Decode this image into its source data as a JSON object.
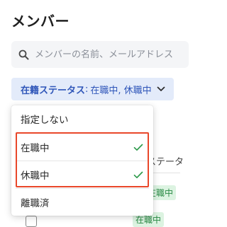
{
  "page": {
    "title": "メンバー"
  },
  "search": {
    "placeholder": "メンバーの名前、メールアドレス"
  },
  "filter": {
    "label": "在籍ステータス",
    "separator": ":",
    "value": "在職中, 休職中"
  },
  "dropdown": {
    "options": [
      {
        "label": "指定しない",
        "selected": false
      },
      {
        "label": "在職中",
        "selected": true
      },
      {
        "label": "休職中",
        "selected": true
      },
      {
        "label": "離職済",
        "selected": false
      }
    ]
  },
  "background_table": {
    "column_header_fragment": "ステータ",
    "status_badges": [
      "在職中",
      "在職中"
    ]
  },
  "colors": {
    "accent": "#2f56b9",
    "chip_bg": "#e3ebfa",
    "check": "#2e9a4c",
    "highlight": "#e9472a",
    "badge_bg": "#dcf3e1"
  },
  "icons": {
    "search": "search-icon",
    "chevron": "chevron-down-icon",
    "check": "check-icon"
  }
}
